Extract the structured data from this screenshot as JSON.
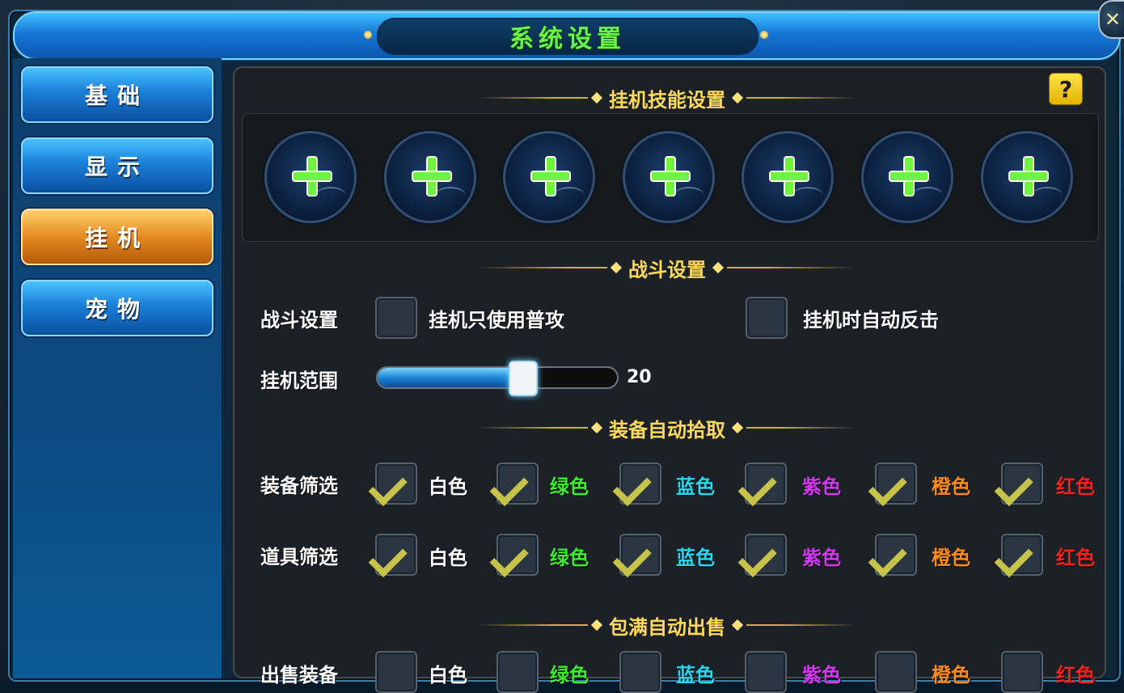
{
  "window": {
    "title": "系统设置",
    "close_glyph": "✕"
  },
  "sidebar": {
    "items": [
      {
        "label": "基础",
        "active": false
      },
      {
        "label": "显示",
        "active": false
      },
      {
        "label": "挂机",
        "active": true
      },
      {
        "label": "宠物",
        "active": false
      }
    ]
  },
  "help_glyph": "?",
  "sections": {
    "skills": {
      "title": "挂机技能设置",
      "slot_count": 7,
      "slot_icon": "add-skill-icon"
    },
    "combat": {
      "title": "战斗设置",
      "row_label": "战斗设置",
      "options": [
        {
          "label": "挂机只使用普攻",
          "checked": false
        },
        {
          "label": "挂机时自动反击",
          "checked": false
        }
      ],
      "range_label": "挂机范围",
      "range_value": "20",
      "range_fraction": 0.6
    },
    "pickup": {
      "title": "装备自动拾取",
      "rows": [
        {
          "label": "装备筛选",
          "options": [
            {
              "label": "白色",
              "color": "#ffffff",
              "checked": true
            },
            {
              "label": "绿色",
              "color": "#3bef2b",
              "checked": true
            },
            {
              "label": "蓝色",
              "color": "#25d8f0",
              "checked": true
            },
            {
              "label": "紫色",
              "color": "#d23af0",
              "checked": true
            },
            {
              "label": "橙色",
              "color": "#ff8c1a",
              "checked": true
            },
            {
              "label": "红色",
              "color": "#ff2020",
              "checked": true
            }
          ]
        },
        {
          "label": "道具筛选",
          "options": [
            {
              "label": "白色",
              "color": "#ffffff",
              "checked": true
            },
            {
              "label": "绿色",
              "color": "#3bef2b",
              "checked": true
            },
            {
              "label": "蓝色",
              "color": "#25d8f0",
              "checked": true
            },
            {
              "label": "紫色",
              "color": "#d23af0",
              "checked": true
            },
            {
              "label": "橙色",
              "color": "#ff8c1a",
              "checked": true
            },
            {
              "label": "红色",
              "color": "#ff2020",
              "checked": true
            }
          ]
        }
      ]
    },
    "autosell": {
      "title": "包满自动出售",
      "row_label": "出售装备",
      "options": [
        {
          "label": "白色",
          "color": "#ffffff",
          "checked": false
        },
        {
          "label": "绿色",
          "color": "#3bef2b",
          "checked": false
        },
        {
          "label": "蓝色",
          "color": "#25d8f0",
          "checked": false
        },
        {
          "label": "紫色",
          "color": "#d23af0",
          "checked": false
        },
        {
          "label": "橙色",
          "color": "#ff8c1a",
          "checked": false
        },
        {
          "label": "红色",
          "color": "#ff2020",
          "checked": false
        }
      ]
    }
  }
}
